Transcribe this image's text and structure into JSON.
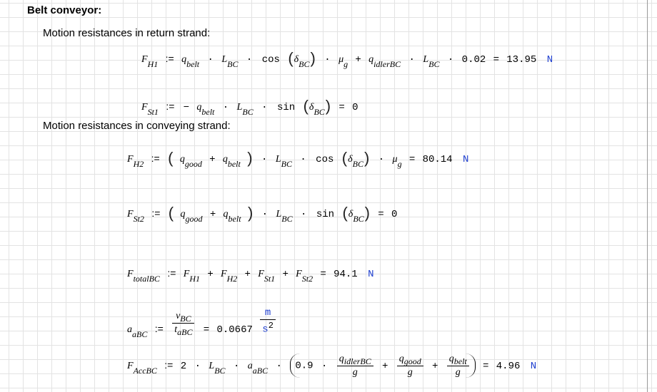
{
  "title": "Belt conveyor:",
  "sections": {
    "return": "Motion resistances in return strand:",
    "conveying": "Motion resistances in conveying strand:"
  },
  "sym": {
    "F": "F",
    "q": "q",
    "L": "L",
    "mu": "μ",
    "delta": "δ",
    "a": "a",
    "v": "v",
    "t": "t",
    "g": "g",
    "H1": "H1",
    "H2": "H2",
    "St1": "St1",
    "St2": "St2",
    "totalBC": "totalBC",
    "AccBC": "AccBC",
    "belt": "belt",
    "good": "good",
    "idlerBC": "idlerBC",
    "BC": "BC",
    "sub_g": "g",
    "aBC": "aBC",
    "cos": "cos",
    "sin": "sin",
    "assign": ":=",
    "eq": "=",
    "plus": "+",
    "minus": "−",
    "dot": "·",
    "lp": "(",
    "rp": ")"
  },
  "consts": {
    "c002": "0.02",
    "c2": "2",
    "c09": "0.9"
  },
  "results": {
    "FH1": "13.95",
    "FSt1": "0",
    "FH2": "80.14",
    "FSt2": "0",
    "FtotalBC": "94.1",
    "aBC": "0.0667",
    "FAccBC": "4.96"
  },
  "units": {
    "N": "N",
    "m": "m",
    "s": "s",
    "exp2": "2"
  }
}
